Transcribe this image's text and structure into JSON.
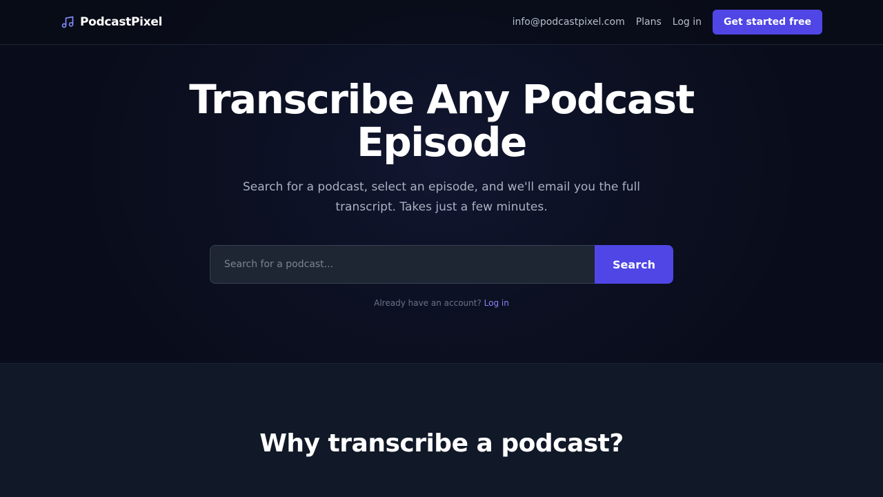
{
  "header": {
    "brand_name": "PodcastPixel",
    "brand_icon": "music-note-icon",
    "nav_email": "info@podcastpixel.com",
    "nav_plans": "Plans",
    "nav_login": "Log in",
    "cta_label": "Get started free"
  },
  "hero": {
    "title_line1": "Transcribe Any Podcast",
    "title_line2": "Episode",
    "subtitle": "Search for a podcast, select an episode, and we'll email you the full transcript. Takes just a few minutes.",
    "search_placeholder": "Search for a podcast...",
    "search_value": "",
    "search_button": "Search",
    "account_prompt": "Already have an account?",
    "account_login": "Log in"
  },
  "section": {
    "heading": "Why transcribe a podcast?"
  },
  "colors": {
    "accent": "#4f46e5",
    "link": "#8b84f7",
    "hero_bg": "#0c1022",
    "section_bg": "#111827"
  }
}
